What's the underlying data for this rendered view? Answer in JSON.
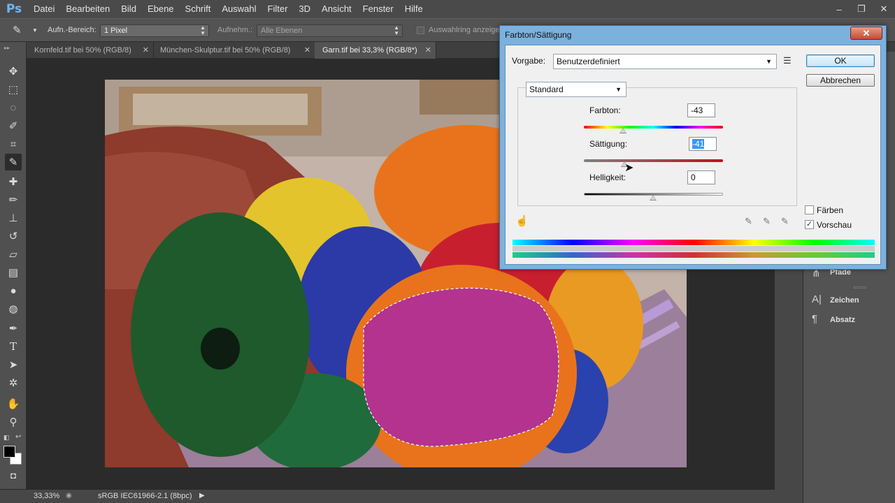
{
  "app": {
    "logo": "Ps",
    "menu": [
      "Datei",
      "Bearbeiten",
      "Bild",
      "Ebene",
      "Schrift",
      "Auswahl",
      "Filter",
      "3D",
      "Ansicht",
      "Fenster",
      "Hilfe"
    ],
    "window_controls": {
      "minimize": "–",
      "restore": "❐",
      "close": "✕"
    }
  },
  "options_bar": {
    "sample_size_label": "Aufn.-Bereich:",
    "sample_size_value": "1 Pixel",
    "sample_label": "Aufnehm.:",
    "sample_value": "Alle Ebenen",
    "show_ring_label": "Auswahlring anzeigen"
  },
  "tabs": [
    {
      "label": "Kornfeld.tif bei 50% (RGB/8)",
      "close": "✕"
    },
    {
      "label": "München-Skulptur.tif bei 50% (RGB/8)",
      "close": "✕"
    },
    {
      "label": "Garn.tif bei 33,3% (RGB/8*)",
      "close": "✕",
      "active": true
    }
  ],
  "status_bar": {
    "zoom": "33,33%",
    "profile": "sRGB IEC61966-2.1 (8bpc)"
  },
  "right_panel": {
    "items": [
      {
        "label": "Pfade",
        "icon": "paths-icon"
      },
      {
        "label": "Zeichen",
        "icon": "character-icon"
      },
      {
        "label": "Absatz",
        "icon": "paragraph-icon"
      }
    ]
  },
  "dialog": {
    "title": "Farbton/Sättigung",
    "close_label": "✕",
    "preset_label": "Vorgabe:",
    "preset_value": "Benutzerdefiniert",
    "channel_value": "Standard",
    "ok_label": "OK",
    "cancel_label": "Abbrechen",
    "hue_label": "Farbton:",
    "hue_value": "-43",
    "saturation_label": "Sättigung:",
    "saturation_value": "-41",
    "lightness_label": "Helligkeit:",
    "lightness_value": "0",
    "colorize_label": "Färben",
    "colorize_checked": false,
    "preview_label": "Vorschau",
    "preview_checked": true,
    "check_mark": "✓"
  },
  "colors": {
    "dialog_border": "#7db1dd",
    "ps_blue": "#6fb6f2",
    "selection_magenta": "#b3338f"
  }
}
